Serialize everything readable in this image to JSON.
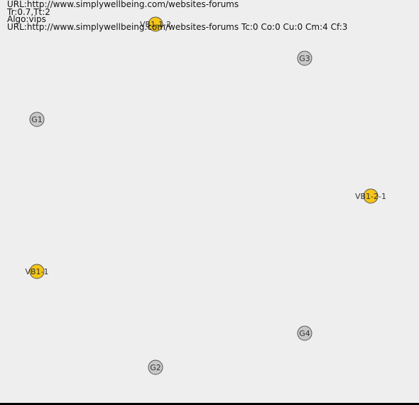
{
  "header": {
    "url_line": "URL:http://www.simplywellbeing.com/websites-forums",
    "params_line": "Tr:0.7,Tt:2",
    "algo_line": "Algo:vips",
    "stats_line": "URL:http://www.simplywellbeing.com/websites-forums Tc:0 Co:0 Cu:0 Cm:4 Cf:3"
  },
  "colors": {
    "background": "#eeeeee",
    "gray_node_fill": "#c8c8c8",
    "yellow_node_fill": "#f5c518",
    "node_stroke": "#555555"
  },
  "nodes": [
    {
      "id": "VB1-1-2",
      "label": "VB1-1-2",
      "kind": "vb"
    },
    {
      "id": "G3",
      "label": "G3",
      "kind": "g"
    },
    {
      "id": "G1",
      "label": "G1",
      "kind": "g"
    },
    {
      "id": "VB1-2-1",
      "label": "VB1-2-1",
      "kind": "vb"
    },
    {
      "id": "VB1-1",
      "label": "VB1-1",
      "kind": "vb"
    },
    {
      "id": "G4",
      "label": "G4",
      "kind": "g"
    },
    {
      "id": "G2",
      "label": "G2",
      "kind": "g"
    }
  ]
}
